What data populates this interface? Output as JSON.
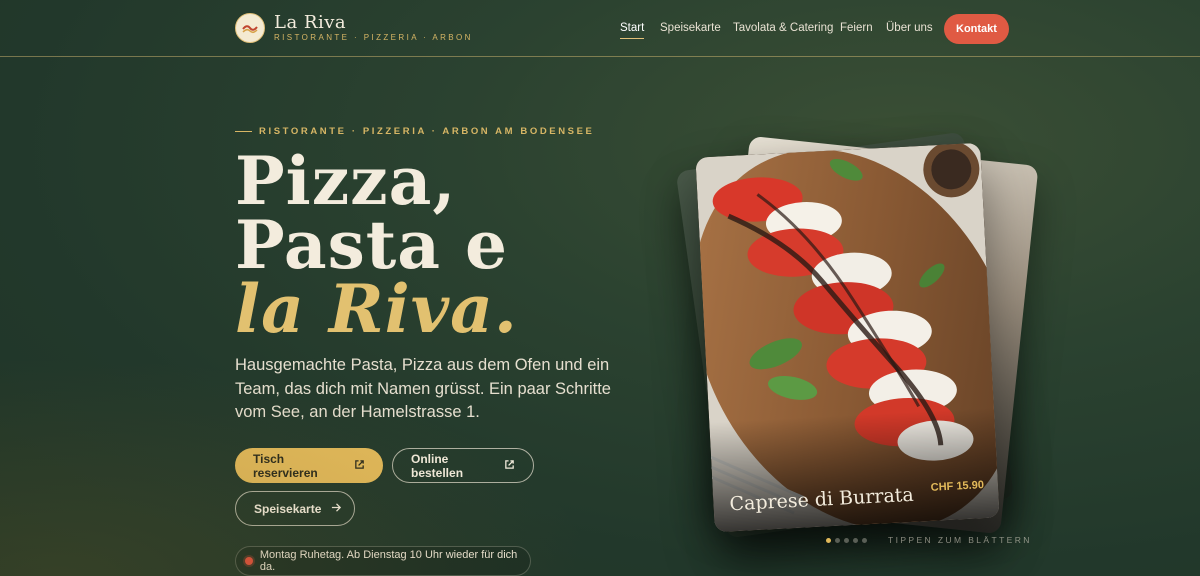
{
  "brand": {
    "name": "La Riva",
    "tagline": "RISTORANTE · PIZZERIA · ARBON"
  },
  "nav": {
    "items": [
      {
        "label": "Start",
        "active": true
      },
      {
        "label": "Speisekarte",
        "active": false
      },
      {
        "label": "Tavolata & Catering",
        "active": false
      },
      {
        "label": "Feiern",
        "active": false
      },
      {
        "label": "Über uns",
        "active": false
      }
    ],
    "cta": "Kontakt"
  },
  "hero": {
    "eyebrow": "RISTORANTE · PIZZERIA · ARBON AM BODENSEE",
    "headline_line1": "Pizza,",
    "headline_line2": "Pasta e",
    "headline_line3": "la Riva.",
    "lead": "Hausgemachte Pasta, Pizza aus dem Ofen und ein Team, das dich mit Namen grüsst. Ein paar Schritte vom See, an der Hamelstrasse 1.",
    "buttons": {
      "reserve": "Tisch reservieren",
      "order": "Online bestellen",
      "menu": "Speisekarte"
    },
    "status": "Montag Ruhetag. Ab Dienstag 10 Uhr wieder für dich da."
  },
  "carousel": {
    "dish_name": "Caprese di Burrata",
    "dish_price": "CHF 15.90",
    "slide_count": 5,
    "active_slide": 1,
    "hint": "TIPPEN ZUM BLÄTTERN"
  },
  "colors": {
    "background": "#2b4230",
    "gold": "#e2b95a",
    "cta_red": "#e05a43",
    "cream": "#f3ecdd"
  }
}
